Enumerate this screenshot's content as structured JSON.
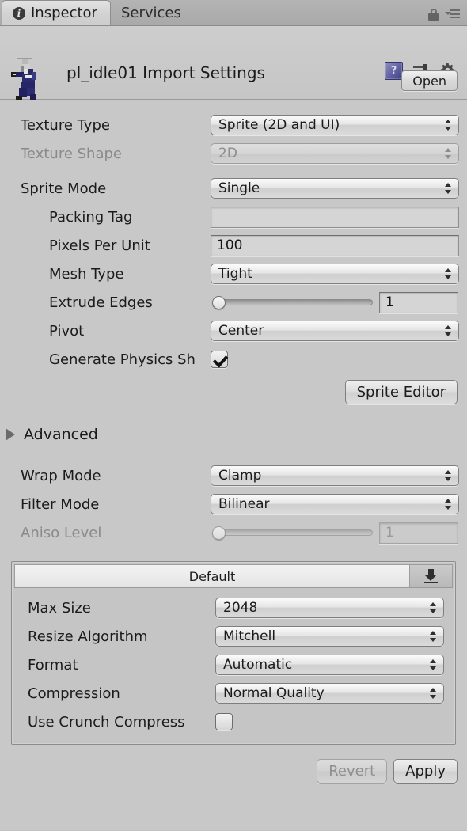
{
  "tabs": [
    {
      "label": "Inspector",
      "icon": "info-icon",
      "active": true
    },
    {
      "label": "Services",
      "icon": "",
      "active": false
    }
  ],
  "tabbar_icons": {
    "lock": "lock-icon",
    "menu": "hamburger-menu-icon"
  },
  "header": {
    "title": "pl_idle01 Import Settings",
    "thumbnail_alt": "pl_idle01 sprite preview",
    "icons": {
      "help": "?",
      "preset": "preset-icon",
      "gear": "gear-icon"
    },
    "open_label": "Open"
  },
  "texture": {
    "type_label": "Texture Type",
    "type_value": "Sprite (2D and UI)",
    "shape_label": "Texture Shape",
    "shape_value": "2D"
  },
  "sprite": {
    "mode_label": "Sprite Mode",
    "mode_value": "Single",
    "packing_tag_label": "Packing Tag",
    "packing_tag_value": "",
    "pixels_per_unit_label": "Pixels Per Unit",
    "pixels_per_unit_value": "100",
    "mesh_type_label": "Mesh Type",
    "mesh_type_value": "Tight",
    "extrude_edges_label": "Extrude Edges",
    "extrude_edges_value": "1",
    "pivot_label": "Pivot",
    "pivot_value": "Center",
    "physics_shape_label": "Generate Physics Sh",
    "physics_shape_checked": true,
    "sprite_editor_label": "Sprite Editor"
  },
  "advanced": {
    "label": "Advanced",
    "expanded": false
  },
  "filtering": {
    "wrap_label": "Wrap Mode",
    "wrap_value": "Clamp",
    "filter_label": "Filter Mode",
    "filter_value": "Bilinear",
    "aniso_label": "Aniso Level",
    "aniso_value": "1"
  },
  "platform": {
    "tab_label": "Default",
    "download_icon": "download-icon",
    "rows": [
      {
        "label": "Max Size",
        "value": "2048"
      },
      {
        "label": "Resize Algorithm",
        "value": "Mitchell"
      },
      {
        "label": "Format",
        "value": "Automatic"
      },
      {
        "label": "Compression",
        "value": "Normal Quality"
      }
    ],
    "crunch_label": "Use Crunch Compress",
    "crunch_checked": false
  },
  "footer": {
    "revert_label": "Revert",
    "apply_label": "Apply"
  },
  "colors": {
    "window_bg": "#c8c8c8",
    "header_bg": "#cdcdcd",
    "accent_blue": "#5b5d9c",
    "text": "#1b1b1b",
    "text_disabled": "#8a8a8a"
  }
}
